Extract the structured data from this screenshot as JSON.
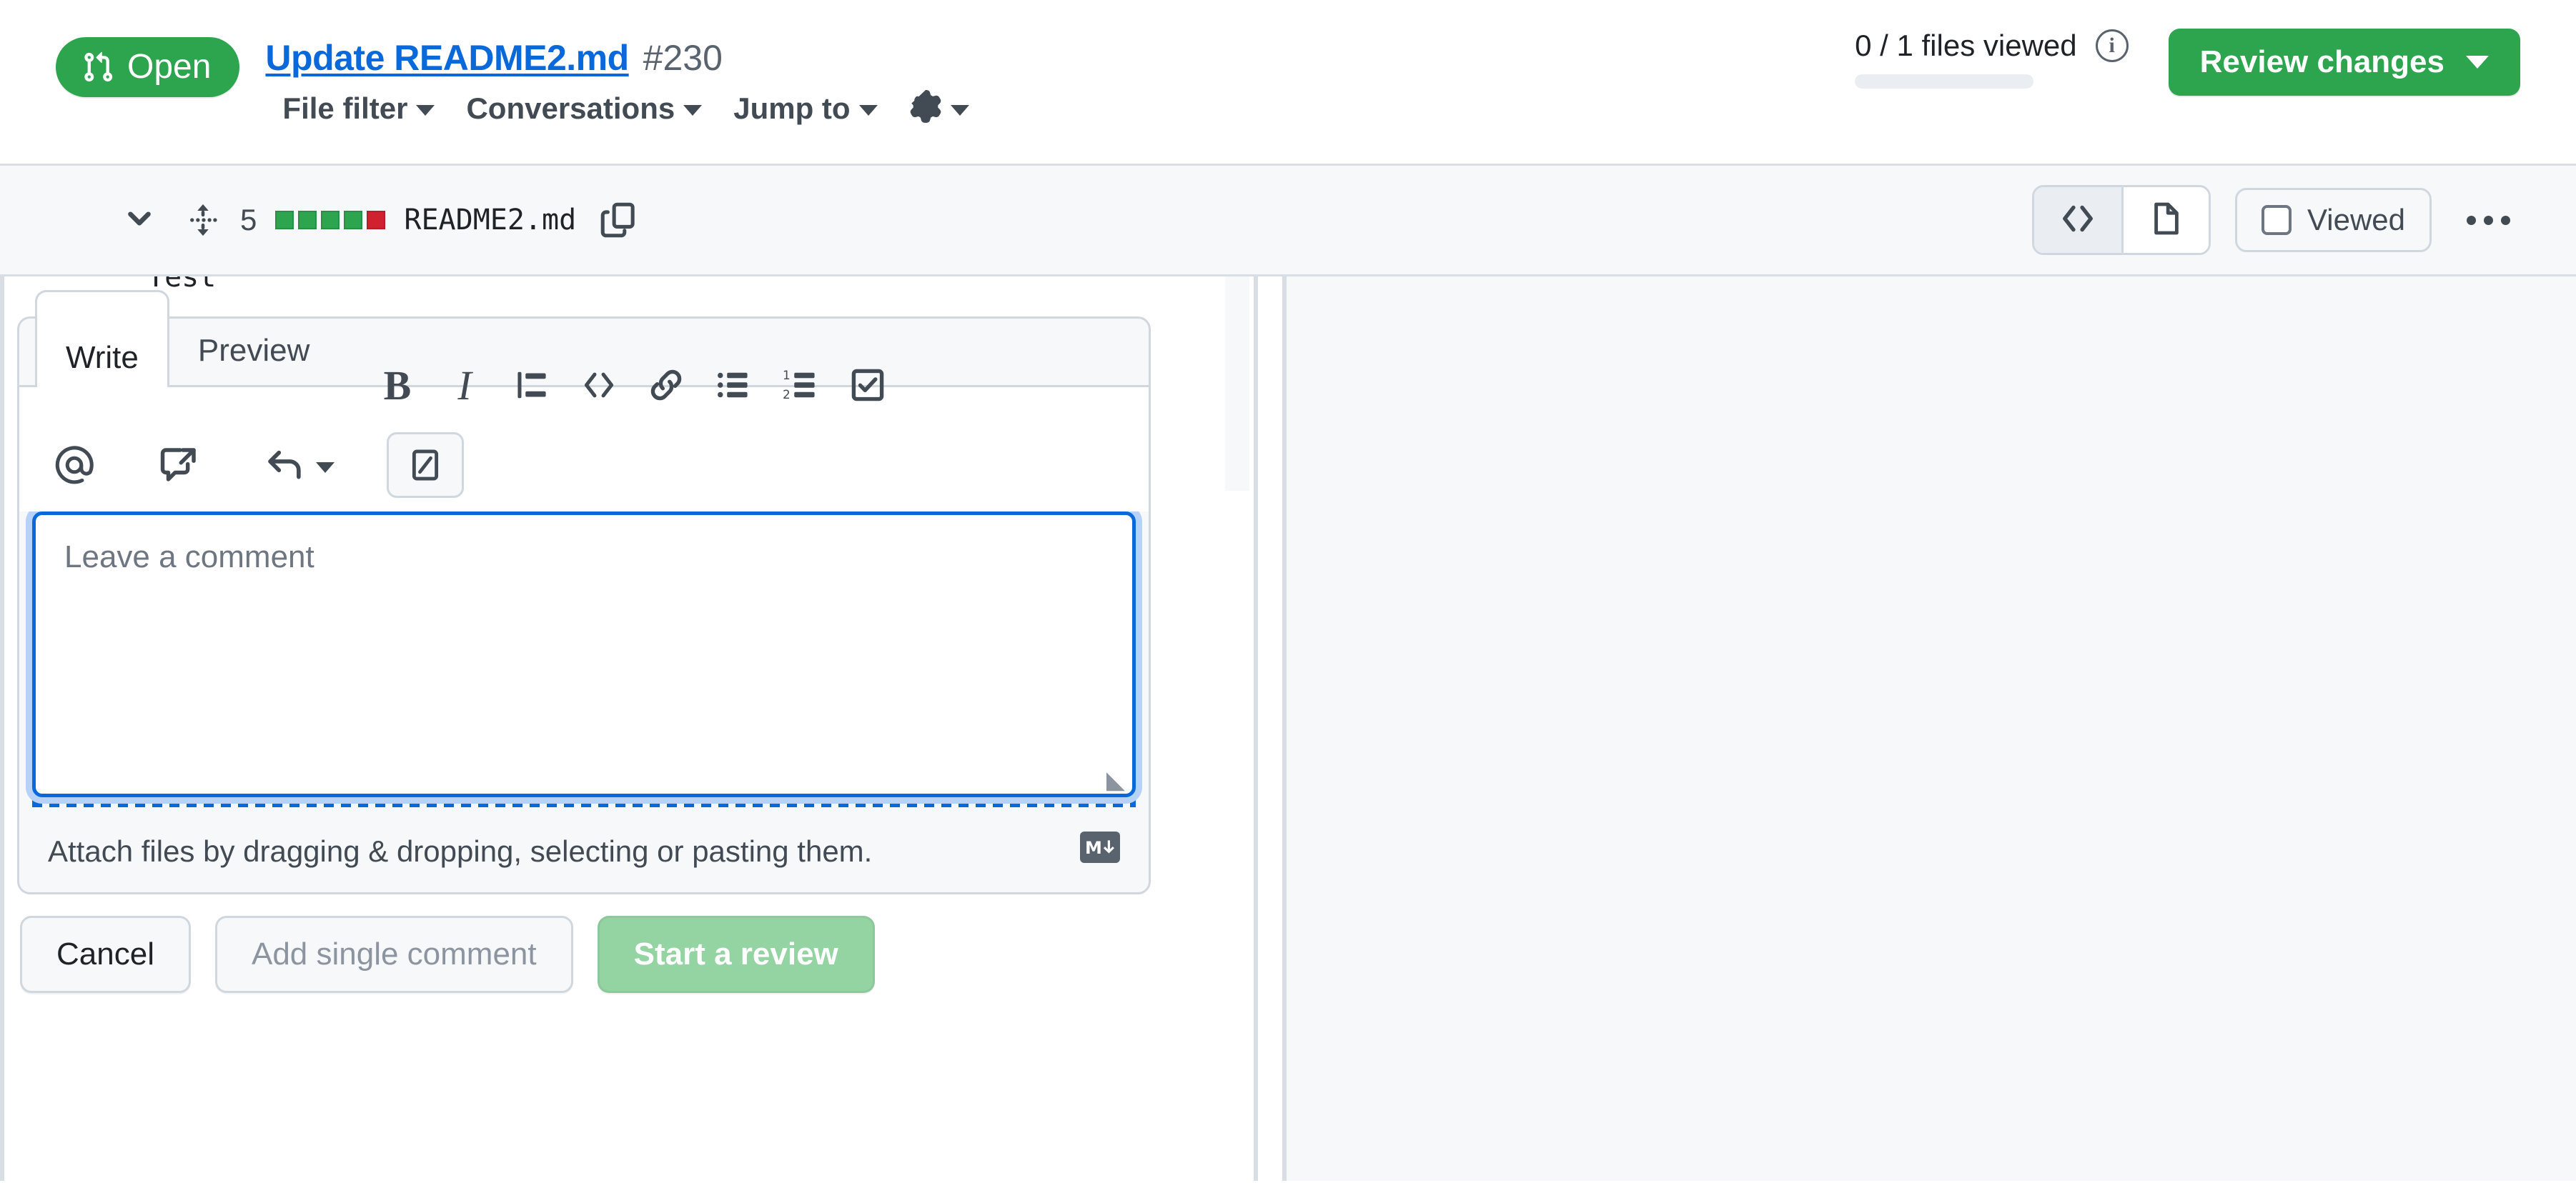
{
  "header": {
    "state_badge": {
      "label": "Open",
      "icon": "git-pull-request-icon",
      "color": "#2da44e"
    },
    "pr_title": "Update README2.md",
    "pr_number": "#230",
    "subnav": [
      {
        "label": "File filter",
        "name": "file-filter",
        "has_caret": true
      },
      {
        "label": "Conversations",
        "name": "conversations",
        "has_caret": true
      },
      {
        "label": "Jump to",
        "name": "jump-to",
        "has_caret": true
      }
    ],
    "settings_icon": "gear-icon",
    "files_viewed": "0 / 1 files viewed",
    "files_viewed_progress_percent": 0,
    "info_icon": "info-icon",
    "info_glyph": "i",
    "review_button": {
      "label": "Review changes",
      "color": "#2da44e"
    }
  },
  "file_header": {
    "collapse_icon": "chevron-down-icon",
    "expand_icon": "unfold-icon",
    "changes_count": "5",
    "diffstat": [
      "add",
      "add",
      "add",
      "add",
      "del"
    ],
    "filename": "README2.md",
    "copy_icon": "copy-path-icon",
    "view_toggle": [
      {
        "name": "view-source-code",
        "icon": "code-icon",
        "active": true
      },
      {
        "name": "view-rendered-file",
        "icon": "file-icon",
        "active": false
      }
    ],
    "viewed_label": "Viewed",
    "viewed_checked": false,
    "kebab_icon": "kebab-horizontal-icon"
  },
  "diff": {
    "clipped_line_text": "Test"
  },
  "comment_form": {
    "tabs": [
      {
        "label": "Write",
        "name": "tab-write",
        "active": true
      },
      {
        "label": "Preview",
        "name": "tab-preview",
        "active": false
      }
    ],
    "toolbar_row1": [
      {
        "name": "bold-icon",
        "glyph": "B"
      },
      {
        "name": "italic-icon",
        "glyph": "I"
      },
      {
        "name": "heading-icon",
        "glyph": ""
      },
      {
        "name": "code-icon",
        "glyph": ""
      },
      {
        "name": "link-icon",
        "glyph": ""
      },
      {
        "name": "unordered-list-icon",
        "glyph": ""
      },
      {
        "name": "ordered-list-icon",
        "glyph": ""
      },
      {
        "name": "task-list-icon",
        "glyph": ""
      }
    ],
    "toolbar_row2": [
      {
        "name": "mention-icon"
      },
      {
        "name": "cross-reference-icon"
      },
      {
        "name": "saved-replies-icon"
      },
      {
        "name": "slash-command-icon"
      }
    ],
    "textarea_placeholder": "Leave a comment",
    "textarea_value": "",
    "attach_hint": "Attach files by dragging & dropping, selecting or pasting them.",
    "markdown_badge": "markdown-icon",
    "actions": [
      {
        "label": "Cancel",
        "name": "cancel-button",
        "style": "default",
        "disabled": false
      },
      {
        "label": "Add single comment",
        "name": "add-single-comment-button",
        "style": "default",
        "disabled": true
      },
      {
        "label": "Start a review",
        "name": "start-review-button",
        "style": "primary",
        "disabled": true
      }
    ]
  },
  "colors": {
    "green": "#2da44e",
    "green_muted": "#94d3a2",
    "red": "#cf222e",
    "link_blue": "#0969da",
    "border": "#d0d7de",
    "canvas_subtle": "#f6f8fa",
    "fg_muted": "#59636e"
  }
}
